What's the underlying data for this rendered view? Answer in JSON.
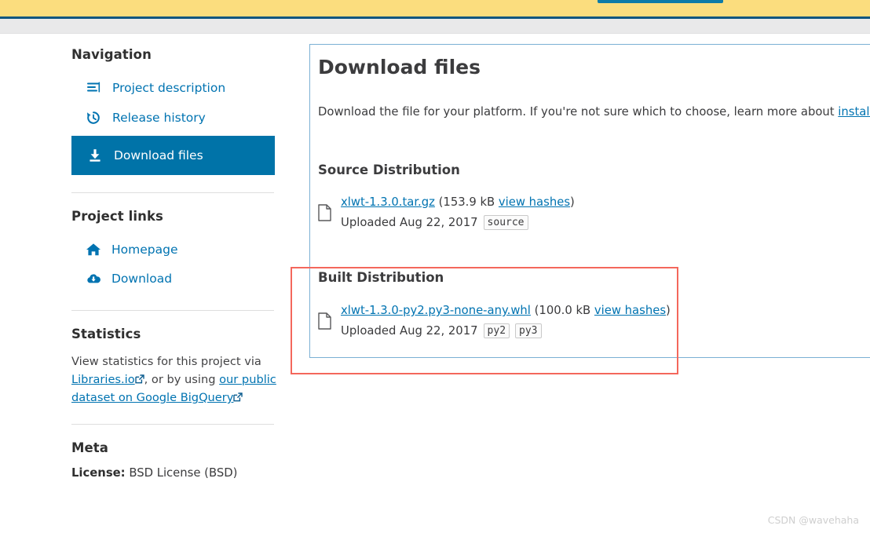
{
  "browser": {
    "notification_bar_color": "#fbdd7e",
    "partial_button_color": "#0e7ba8"
  },
  "sidebar": {
    "navigation_heading": "Navigation",
    "nav_items": [
      {
        "label": "Project description",
        "icon": "list-lines-icon",
        "active": false
      },
      {
        "label": "Release history",
        "icon": "history-clock-icon",
        "active": false
      },
      {
        "label": "Download files",
        "icon": "download-tray-icon",
        "active": true
      }
    ],
    "project_links_heading": "Project links",
    "project_links": [
      {
        "label": "Homepage",
        "icon": "home-icon"
      },
      {
        "label": "Download",
        "icon": "cloud-download-icon"
      }
    ],
    "statistics_heading": "Statistics",
    "statistics_text_part1": "View statistics for this project via ",
    "statistics_link1": "Libraries.io",
    "statistics_text_part2": ", or by using ",
    "statistics_link2": "our public dataset on Google BigQuery",
    "meta_heading": "Meta",
    "meta_license_label": "License:",
    "meta_license_value": " BSD License (BSD)"
  },
  "main": {
    "title": "Download files",
    "description_prefix": "Download the file for your platform. If you're not sure which to choose, learn more about ",
    "description_link": "installing packa",
    "source_distribution_heading": "Source Distribution",
    "built_distribution_heading": "Built Distribution",
    "files": [
      {
        "name": "xlwt-1.3.0.tar.gz",
        "size_open": " (",
        "size": "153.9 kB ",
        "hashes_link": "view hashes",
        "size_close": ")",
        "uploaded": "Uploaded Aug 22, 2017",
        "tags": [
          "source"
        ]
      },
      {
        "name": "xlwt-1.3.0-py2.py3-none-any.whl",
        "size_open": " (",
        "size": "100.0 kB ",
        "hashes_link": "view hashes",
        "size_close": ")",
        "uploaded": "Uploaded Aug 22, 2017",
        "tags": [
          "py2",
          "py3"
        ]
      }
    ]
  },
  "annotation": {
    "highlight_color": "#f4675c"
  },
  "watermark": {
    "text": "CSDN @wavehaha"
  },
  "colors": {
    "link": "#0073b1",
    "active_nav_bg": "#0073a8",
    "card_border": "#7bb0d4"
  }
}
